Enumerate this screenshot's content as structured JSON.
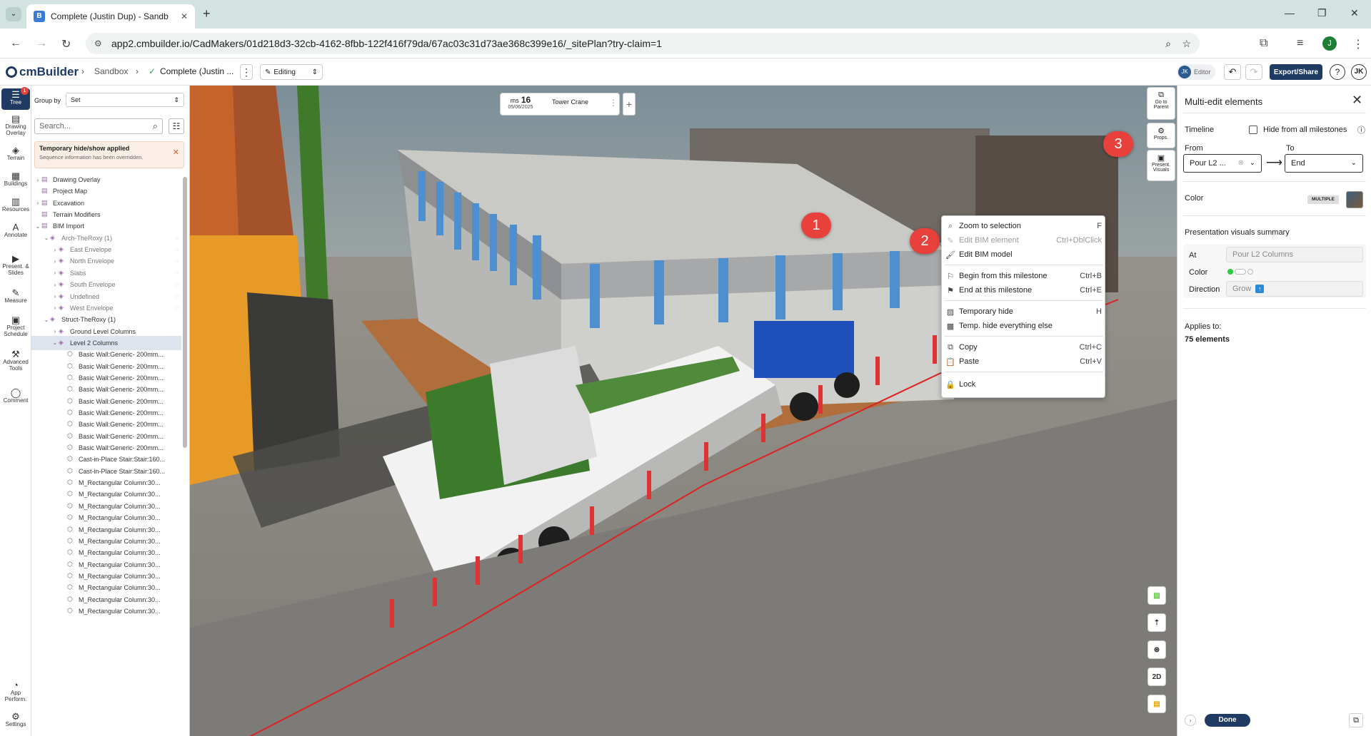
{
  "browser": {
    "tab_title": "Complete (Justin Dup) - Sandb",
    "url": "app2.cmbuilder.io/CadMakers/01d218d3-32cb-4162-8fbb-122f416f79da/67ac03c31d73ae368c399e16/_sitePlan?try-claim=1",
    "profile_initial": "J"
  },
  "header": {
    "logo": "cmBuilder",
    "breadcrumb_1": "Sandbox",
    "breadcrumb_2": "Complete (Justin ...",
    "mode": "Editing",
    "editor_initials": "JK",
    "editor_label": "Editor",
    "export_label": "Export/Share",
    "user_initials": "JK"
  },
  "rail": [
    {
      "label": "Tree",
      "icon": "tree-icon"
    },
    {
      "label": "Drawing Overlay",
      "icon": "drawing-icon"
    },
    {
      "label": "Terrain",
      "icon": "terrain-icon"
    },
    {
      "label": "Buildings",
      "icon": "buildings-icon"
    },
    {
      "label": "Resources",
      "icon": "resources-icon"
    },
    {
      "label": "Annotate",
      "icon": "annotate-icon"
    },
    {
      "label": "Present. & Slides",
      "icon": "slides-icon"
    },
    {
      "label": "Measure",
      "icon": "measure-icon"
    },
    {
      "label": "Project Schedule",
      "icon": "schedule-icon"
    },
    {
      "label": "Advanced Tools",
      "icon": "tools-icon"
    },
    {
      "label": "Comment",
      "icon": "comment-icon"
    },
    {
      "label": "App Perform.",
      "icon": "perf-icon"
    },
    {
      "label": "Settings",
      "icon": "gear-icon"
    }
  ],
  "tree_badge": "1",
  "tree": {
    "group_by_label": "Group by",
    "group_by_value": "Set",
    "search_placeholder": "Search...",
    "notice_title": "Temporary hide/show applied",
    "notice_sub": "Sequence information has been overridden.",
    "rows": [
      "Drawing Overlay",
      "Project Map",
      "Excavation",
      "Terrain Modifiers",
      "BIM Import",
      "Arch-TheRoxy (1)",
      "East Envelope",
      "North Envelope",
      "Slabs",
      "South Envelope",
      "Undefined",
      "West Envelope",
      "Struct-TheRoxy (1)",
      "Ground Level Columns",
      "Level 2 Columns",
      "Basic Wall:Generic- 200mm...",
      "Basic Wall:Generic- 200mm...",
      "Basic Wall:Generic- 200mm...",
      "Basic Wall:Generic- 200mm...",
      "Basic Wall:Generic- 200mm...",
      "Basic Wall:Generic- 200mm...",
      "Basic Wall:Generic- 200mm...",
      "Basic Wall:Generic- 200mm...",
      "Basic Wall:Generic- 200mm...",
      "Cast-in-Place Stair:Stair:160...",
      "Cast-in-Place Stair:Stair:160...",
      "M_Rectangular Column:30...",
      "M_Rectangular Column:30...",
      "M_Rectangular Column:30...",
      "M_Rectangular Column:30...",
      "M_Rectangular Column:30...",
      "M_Rectangular Column:30...",
      "M_Rectangular Column:30...",
      "M_Rectangular Column:30...",
      "M_Rectangular Column:30...",
      "M_Rectangular Column:30...",
      "M_Rectangular Column:30...",
      "M_Rectangular Column:30..."
    ]
  },
  "milestone": {
    "prefix": "ms",
    "number": "16",
    "date": "05/06/2025",
    "name": "Tower Crane"
  },
  "viewport_tools": {
    "go_to_parent": "Go to Parent",
    "props": "Props.",
    "present_visuals": "Present. Visuals",
    "mode_2d": "2D"
  },
  "context_menu": [
    {
      "label": "Zoom to selection",
      "shortcut": "F",
      "icon": "zoom-icon",
      "disabled": false
    },
    {
      "label": "Edit BIM element",
      "shortcut": "Ctrl+DblClick",
      "icon": "edit-element-icon",
      "disabled": true
    },
    {
      "label": "Edit BIM model",
      "shortcut": "",
      "icon": "brush-icon",
      "disabled": false
    },
    {
      "label": "Begin from this milestone",
      "shortcut": "Ctrl+B",
      "icon": "flag-icon",
      "disabled": false
    },
    {
      "label": "End at this milestone",
      "shortcut": "Ctrl+E",
      "icon": "flag-end-icon",
      "disabled": false
    },
    {
      "label": "Temporary hide",
      "shortcut": "H",
      "icon": "hide-icon",
      "disabled": false
    },
    {
      "label": "Temp. hide everything else",
      "shortcut": "",
      "icon": "hide-others-icon",
      "disabled": false
    },
    {
      "label": "Copy",
      "shortcut": "Ctrl+C",
      "icon": "copy-icon",
      "disabled": false
    },
    {
      "label": "Paste",
      "shortcut": "Ctrl+V",
      "icon": "paste-icon",
      "disabled": false
    },
    {
      "label": "Lock",
      "shortcut": "",
      "icon": "lock-icon",
      "disabled": false
    }
  ],
  "callouts": [
    "1",
    "2",
    "3"
  ],
  "panel": {
    "title": "Multi-edit elements",
    "timeline_label": "Timeline",
    "hide_all_label": "Hide from all milestones",
    "from_label": "From",
    "from_value": "Pour L2 ...",
    "to_label": "To",
    "to_value": "End",
    "color_label": "Color",
    "color_badge": "MULTIPLE",
    "summary_title": "Presentation visuals summary",
    "at_label": "At",
    "at_value": "Pour L2 Columns",
    "color2_label": "Color",
    "direction_label": "Direction",
    "direction_value": "Grow",
    "applies_label": "Applies to:",
    "applies_value": "75 elements",
    "done_label": "Done"
  },
  "colors": {
    "accent": "#1f3b63",
    "callout": "#e8413b",
    "selection": "#dde4ee"
  }
}
